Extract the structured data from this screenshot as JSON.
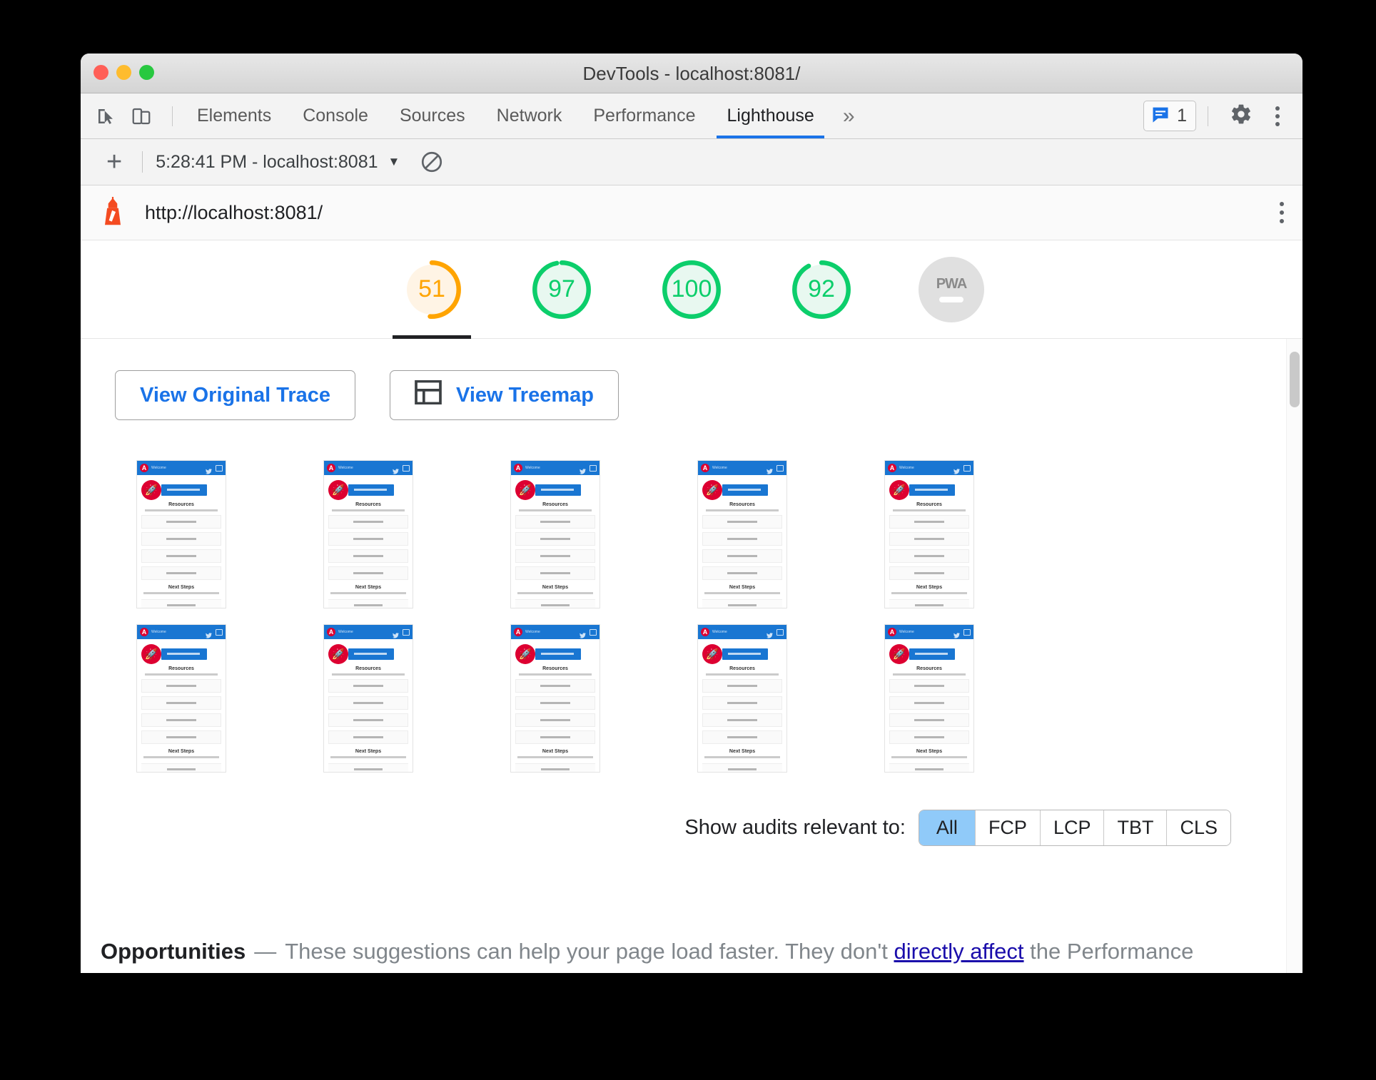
{
  "window": {
    "title": "DevTools - localhost:8081/",
    "traffic_lights": [
      "close",
      "minimize",
      "zoom"
    ]
  },
  "devtools_tabs": {
    "inspect_icon": "inspect-cursor-icon",
    "device_icon": "device-toolbar-icon",
    "items": [
      {
        "label": "Elements",
        "active": false
      },
      {
        "label": "Console",
        "active": false
      },
      {
        "label": "Sources",
        "active": false
      },
      {
        "label": "Network",
        "active": false
      },
      {
        "label": "Performance",
        "active": false
      },
      {
        "label": "Lighthouse",
        "active": true
      }
    ],
    "more_label": "»",
    "message_count": "1",
    "message_icon": "message-icon",
    "settings_icon": "gear-icon",
    "more_icon": "kebab-menu-icon"
  },
  "lighthouse_toolbar": {
    "add_label": "+",
    "run_label": "5:28:41 PM - localhost:8081",
    "caret": "▼",
    "clear_icon": "clear-no-entry-icon"
  },
  "url_bar": {
    "logo_icon": "lighthouse-icon",
    "url": "http://localhost:8081/",
    "menu_icon": "kebab-menu-icon"
  },
  "scores": {
    "gauges": [
      {
        "name": "performance",
        "value": "51",
        "percent": 51,
        "color": "#ffa400",
        "track": "#fff4e5",
        "selected": true
      },
      {
        "name": "accessibility",
        "value": "97",
        "percent": 97,
        "color": "#0cce6b",
        "track": "#e8f8f0",
        "selected": false
      },
      {
        "name": "best-practices",
        "value": "100",
        "percent": 100,
        "color": "#0cce6b",
        "track": "#e8f8f0",
        "selected": false
      },
      {
        "name": "seo",
        "value": "92",
        "percent": 92,
        "color": "#0cce6b",
        "track": "#e8f8f0",
        "selected": false
      }
    ],
    "pwa": {
      "label": "PWA",
      "state": "not-applicable",
      "color": "#e0e0e0"
    }
  },
  "actions": {
    "view_original_trace": "View Original Trace",
    "view_treemap": "View Treemap",
    "treemap_icon": "treemap-icon"
  },
  "filmstrip": {
    "count": 10,
    "thumbnail": {
      "brand": "Welcome",
      "logo_letter": "A",
      "banner_text": "rethink reactive",
      "heading": "Resources",
      "subtext": "Here are some links to help you get started",
      "cards": [
        "Learn Angular",
        "CLI Documentation",
        "Angular Blog",
        "Angular DevTools"
      ],
      "next_heading": "Next Steps",
      "next_subtext": "What do you want to do next with your app?",
      "footer_item": "New Component"
    }
  },
  "filters": {
    "label": "Show audits relevant to:",
    "options": [
      {
        "label": "All",
        "active": true
      },
      {
        "label": "FCP",
        "active": false
      },
      {
        "label": "LCP",
        "active": false
      },
      {
        "label": "TBT",
        "active": false
      },
      {
        "label": "CLS",
        "active": false
      }
    ]
  },
  "opportunities": {
    "title": "Opportunities",
    "dash": "—",
    "text_before": "These suggestions can help your page load faster. They don't ",
    "link": "directly affect",
    "text_after": " the Performance"
  },
  "colors": {
    "accent_blue": "#1a73e8",
    "score_orange": "#ffa400",
    "score_green": "#0cce6b",
    "link_blue": "#1a0dab",
    "filter_active": "#90caf9"
  }
}
